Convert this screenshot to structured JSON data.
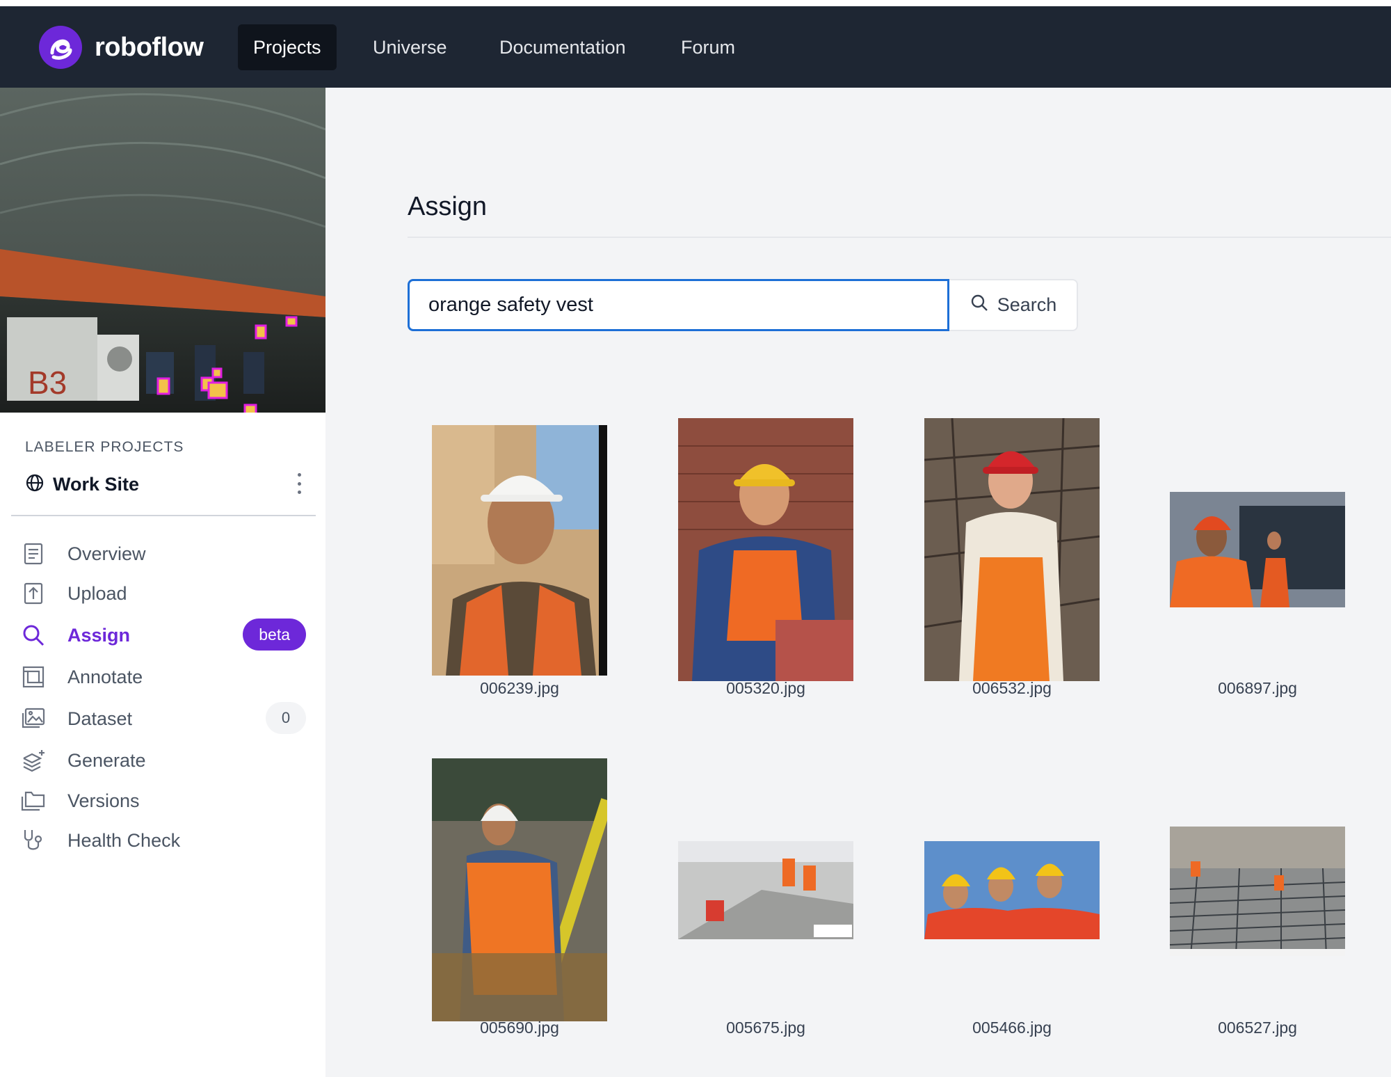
{
  "nav": {
    "brand": "roboflow",
    "items": [
      {
        "label": "Projects",
        "active": true
      },
      {
        "label": "Universe",
        "active": false
      },
      {
        "label": "Documentation",
        "active": false
      },
      {
        "label": "Forum",
        "active": false
      }
    ]
  },
  "sidebar": {
    "section_label": "LABELER PROJECTS",
    "project_name": "Work Site",
    "preview_label_text": "B3",
    "menu": [
      {
        "label": "Overview",
        "icon": "document-icon"
      },
      {
        "label": "Upload",
        "icon": "upload-icon"
      },
      {
        "label": "Assign",
        "icon": "search-icon",
        "active": true,
        "badge": "beta"
      },
      {
        "label": "Annotate",
        "icon": "annotate-icon"
      },
      {
        "label": "Dataset",
        "icon": "images-icon",
        "count": "0"
      },
      {
        "label": "Generate",
        "icon": "layers-plus-icon"
      },
      {
        "label": "Versions",
        "icon": "folders-icon"
      },
      {
        "label": "Health Check",
        "icon": "stethoscope-icon"
      }
    ]
  },
  "main": {
    "title": "Assign",
    "search": {
      "value": "orange safety vest",
      "button_label": "Search"
    },
    "images": [
      {
        "filename": "006239.jpg"
      },
      {
        "filename": "005320.jpg"
      },
      {
        "filename": "006532.jpg"
      },
      {
        "filename": "006897.jpg"
      },
      {
        "filename": "005690.jpg"
      },
      {
        "filename": "005675.jpg"
      },
      {
        "filename": "005466.jpg"
      },
      {
        "filename": "006527.jpg"
      }
    ]
  },
  "colors": {
    "nav_bg": "#1e2633",
    "accent": "#6d28d9",
    "focus_blue": "#1d6fd6"
  }
}
